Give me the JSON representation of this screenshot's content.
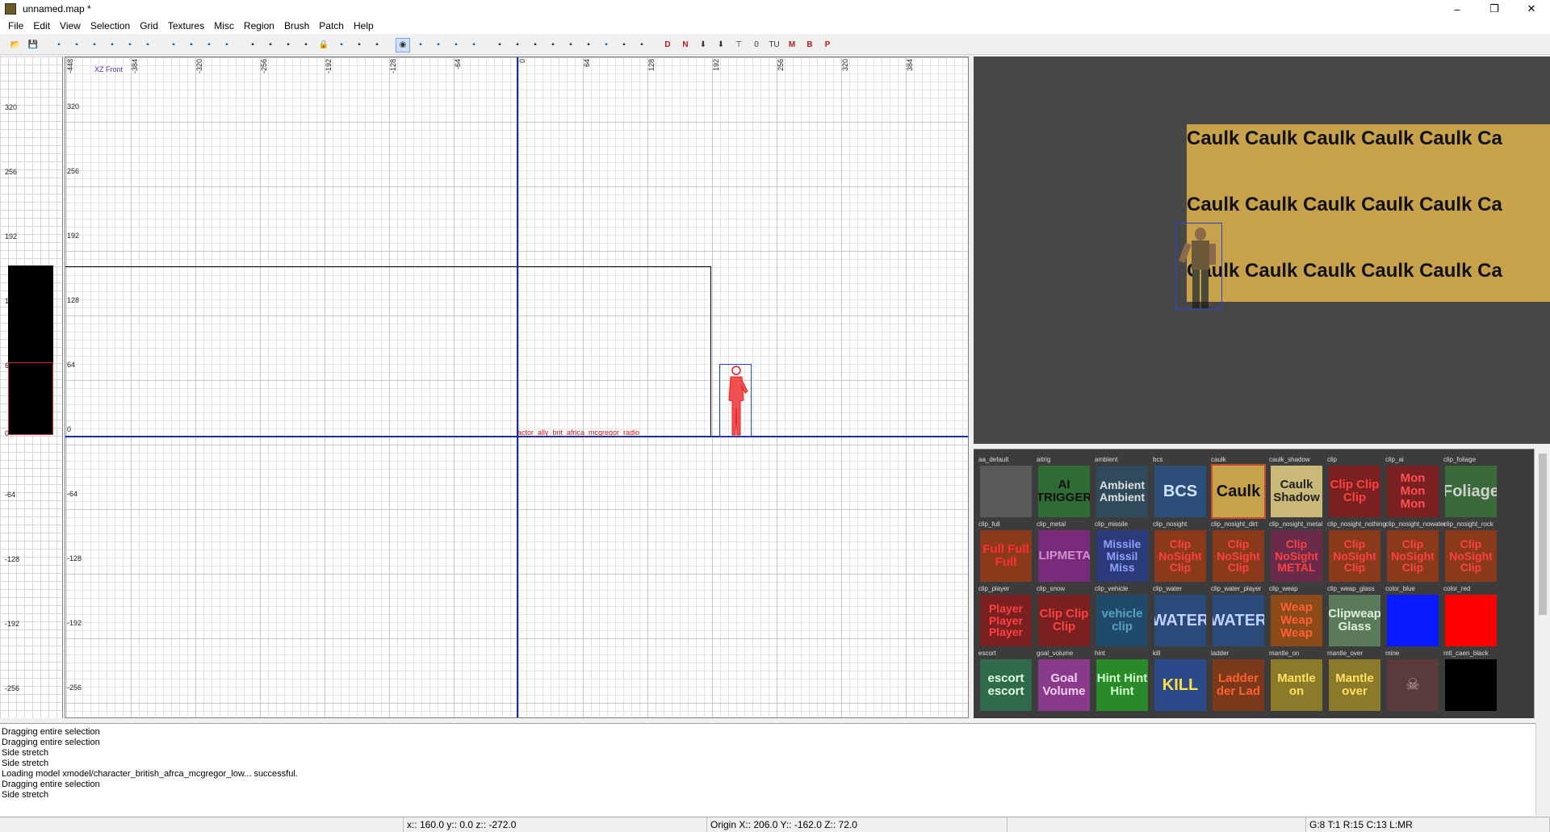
{
  "window": {
    "title": "unnamed.map *",
    "minimize": "–",
    "maximize": "❐",
    "close": "✕"
  },
  "menu": [
    "File",
    "Edit",
    "View",
    "Selection",
    "Grid",
    "Textures",
    "Misc",
    "Region",
    "Brush",
    "Patch",
    "Help"
  ],
  "toolbar": {
    "buttons": [
      "open-icon",
      "save-icon",
      "flip-x-icon",
      "rotate-x-icon",
      "flip-y-icon",
      "rotate-y-icon",
      "flip-z-icon",
      "rotate-z-icon",
      "select-complete-icon",
      "select-touching-icon",
      "select-inside-icon",
      "select-partial-icon",
      "csg-subtract-icon",
      "csg-merge-icon",
      "make-hollow-icon",
      "clipper-icon",
      "lock-icon",
      "rotate-tex-icon",
      "tex-lock-icon",
      "scale-lock-icon",
      "camera-icon",
      "view-swap-icon",
      "view-x-icon",
      "view-y-icon",
      "view-z-icon",
      "entity-red-icon",
      "curve-icon",
      "patch-icon",
      "drag-icon",
      "texture-icon",
      "brush-icon",
      "selection-icon",
      "group-icon",
      "filter-icon",
      "red-d-icon",
      "red-n-icon",
      "arrow-down-icon",
      "arrow-green-icon",
      "tree-icon",
      "zero-icon",
      "tu-icon",
      "m-icon",
      "b-icon",
      "p-icon"
    ],
    "labels": [
      "TU",
      "M",
      "B",
      "P"
    ]
  },
  "zview": {
    "ticks": [
      "320",
      "256",
      "192",
      "1",
      "6",
      "0",
      "-64",
      "-128",
      "-192",
      "-256"
    ]
  },
  "gridview": {
    "view_label": "XZ Front",
    "top_ticks": [
      "-448",
      "-384",
      "-320",
      "-256",
      "-192",
      "-128",
      "-64",
      "0",
      "64",
      "128",
      "192",
      "256",
      "320",
      "384"
    ],
    "left_ticks": [
      "320",
      "256",
      "192",
      "128",
      "64",
      "0",
      "-64",
      "-128",
      "-192",
      "-256"
    ],
    "entity_name": "actor_ally_brit_africa_mcgregor_radio"
  },
  "camview": {
    "wall_text": "Caulk Caulk Caulk Caulk Caulk Ca"
  },
  "textures": [
    {
      "name": "aa_default",
      "label": "",
      "bg": "#5a5a5a",
      "fg": "#888"
    },
    {
      "name": "aitrig",
      "label": "AI TRIGGER",
      "bg": "#2f6b34",
      "fg": "#111"
    },
    {
      "name": "ambient",
      "label": "Ambient Ambient",
      "bg": "#2f4a5a",
      "fg": "#e0e0e0"
    },
    {
      "name": "bcs",
      "label": "BCS",
      "bg": "#2c4f7a",
      "fg": "#cfe4ff"
    },
    {
      "name": "caulk",
      "label": "Caulk",
      "bg": "#c8a24a",
      "fg": "#111",
      "selected": true
    },
    {
      "name": "caulk_shadow",
      "label": "Caulk Shadow",
      "bg": "#cbb97a",
      "fg": "#222"
    },
    {
      "name": "clip",
      "label": "Clip Clip Clip",
      "bg": "#7a2020",
      "fg": "#ff4040"
    },
    {
      "name": "clip_ai",
      "label": "Mon Mon Mon",
      "bg": "#7a2020",
      "fg": "#ff5050"
    },
    {
      "name": "clip_foliage",
      "label": "Foliage",
      "bg": "#3a6a3a",
      "fg": "#d0d0d0"
    },
    {
      "name": "clip_full",
      "label": "Full Full Full",
      "bg": "#8a3a1a",
      "fg": "#ff3030"
    },
    {
      "name": "clip_metal",
      "label": "CLIPMETAL",
      "bg": "#7a2a7a",
      "fg": "#d090d0"
    },
    {
      "name": "clip_missile",
      "label": "Missile Missil Miss",
      "bg": "#2a3a7a",
      "fg": "#90a0ff"
    },
    {
      "name": "clip_nosight",
      "label": "Clip NoSight Clip",
      "bg": "#8a3a1a",
      "fg": "#ff4040"
    },
    {
      "name": "clip_nosight_dirt",
      "label": "Clip NoSight Clip",
      "bg": "#8a3a1a",
      "fg": "#ff4040"
    },
    {
      "name": "clip_nosight_metal",
      "label": "Clip NoSight METAL",
      "bg": "#6a2a4a",
      "fg": "#ff4040"
    },
    {
      "name": "clip_nosight_nothing",
      "label": "Clip NoSight Clip",
      "bg": "#8a3a1a",
      "fg": "#ff4040"
    },
    {
      "name": "clip_nosight_nowater",
      "label": "Clip NoSight Clip",
      "bg": "#8a3a1a",
      "fg": "#ff4040"
    },
    {
      "name": "clip_nosight_rock",
      "label": "Clip NoSight Clip",
      "bg": "#8a3a1a",
      "fg": "#ff4040"
    },
    {
      "name": "clip_player",
      "label": "Player Player Player",
      "bg": "#7a2020",
      "fg": "#ff4040"
    },
    {
      "name": "clip_snow",
      "label": "Clip Clip Clip",
      "bg": "#7a2020",
      "fg": "#ff4040"
    },
    {
      "name": "clip_vehicle",
      "label": "vehicle clip",
      "bg": "#1f4a6a",
      "fg": "#5aa0c0"
    },
    {
      "name": "clip_water",
      "label": "WATER",
      "bg": "#2a4a7a",
      "fg": "#c0d0ff"
    },
    {
      "name": "clip_water_player",
      "label": "WATER",
      "bg": "#2a4a7a",
      "fg": "#c0d0ff"
    },
    {
      "name": "clip_weap",
      "label": "Weap Weap Weap",
      "bg": "#8a4a1a",
      "fg": "#ff6030"
    },
    {
      "name": "clip_weap_glass",
      "label": "Clipweap Glass",
      "bg": "#5a7a5a",
      "fg": "#e0f0e0"
    },
    {
      "name": "color_blue",
      "label": "",
      "bg": "#0a1aff",
      "fg": "#fff"
    },
    {
      "name": "color_red",
      "label": "",
      "bg": "#ff0000",
      "fg": "#fff"
    },
    {
      "name": "escort",
      "label": "escort escort",
      "bg": "#2f6a4a",
      "fg": "#e0ffe0"
    },
    {
      "name": "goal_volume",
      "label": "Goal Volume",
      "bg": "#8a3a8a",
      "fg": "#f0d0f0"
    },
    {
      "name": "hint",
      "label": "Hint Hint Hint",
      "bg": "#2a8a2a",
      "fg": "#d0ffd0"
    },
    {
      "name": "kill",
      "label": "KILL",
      "bg": "#2a4a8a",
      "fg": "#ffe040"
    },
    {
      "name": "ladder",
      "label": "Ladder der Lad",
      "bg": "#7a3a1a",
      "fg": "#ff6030"
    },
    {
      "name": "mantle_on",
      "label": "Mantle on",
      "bg": "#8a7a2a",
      "fg": "#ffe060"
    },
    {
      "name": "mantle_over",
      "label": "Mantle over",
      "bg": "#8a7a2a",
      "fg": "#ffe060"
    },
    {
      "name": "mine",
      "label": "☠",
      "bg": "#5a3a3a",
      "fg": "#c0a0a0"
    },
    {
      "name": "mtl_caen_black",
      "label": "",
      "bg": "#000000",
      "fg": "#fff"
    }
  ],
  "console": [
    "Dragging entire selection",
    "Dragging entire selection",
    "Side stretch",
    "Side stretch",
    "Loading model xmodel/character_british_afrca_mcgregor_low... successful.",
    "Dragging entire selection",
    "Side stretch"
  ],
  "status": {
    "coords": "x:: 160.0  y:: 0.0  z:: -272.0",
    "origin": "Origin X:: 206.0  Y:: -162.0  Z:: 72.0",
    "grid": "G:8 T:1 R:15 C:13 L:MR"
  }
}
